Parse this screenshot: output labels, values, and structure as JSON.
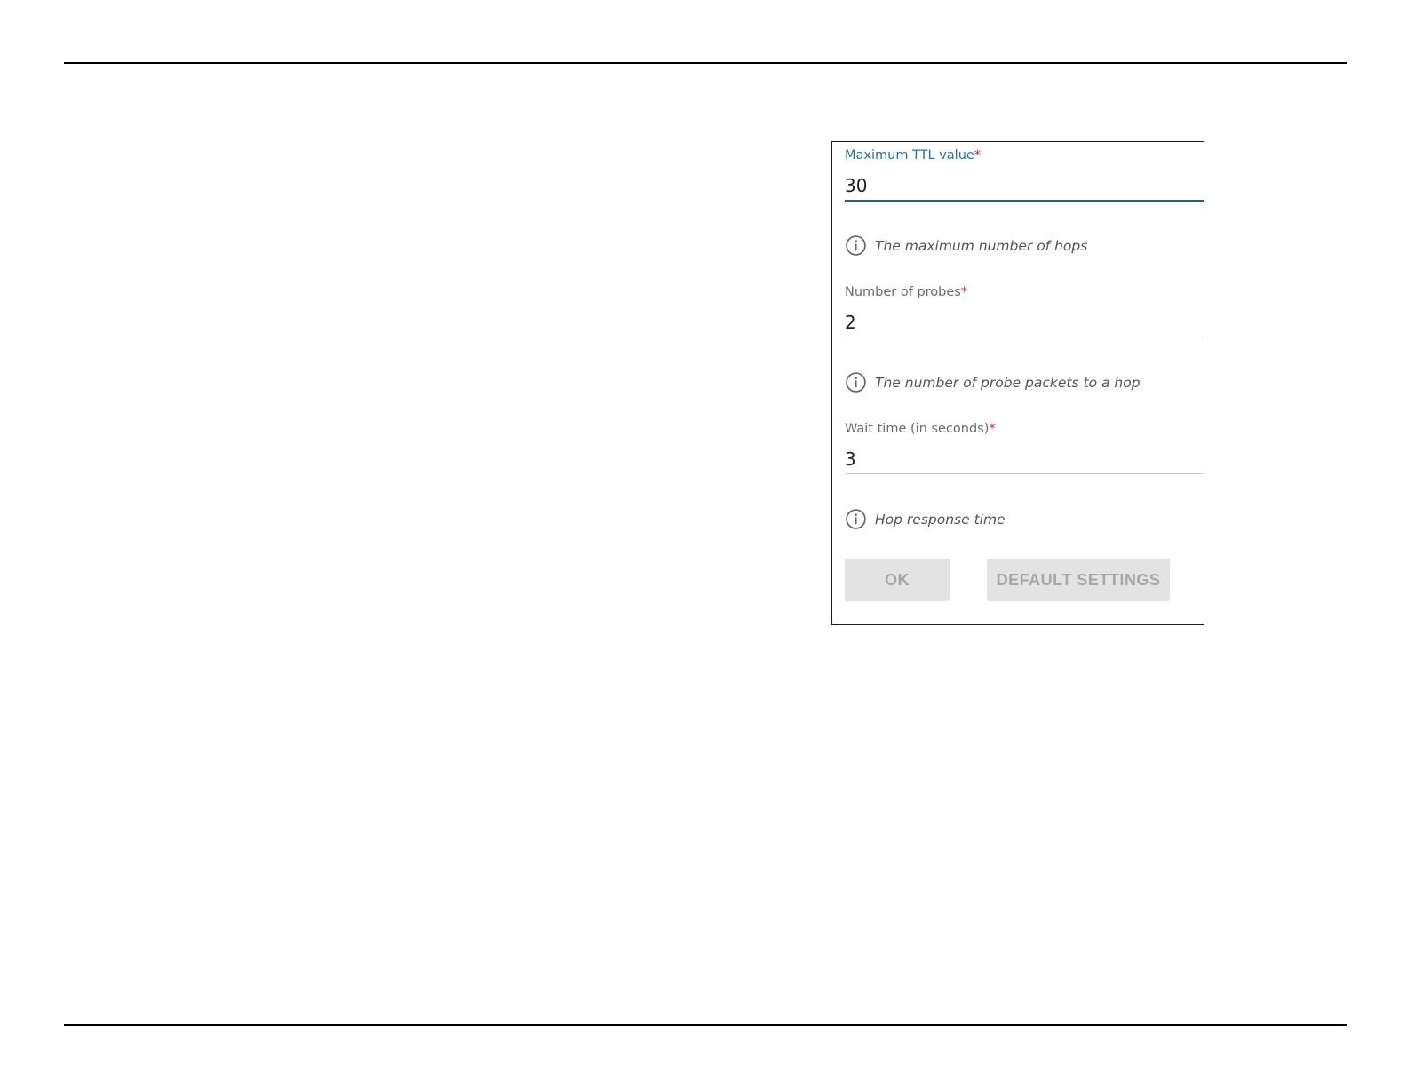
{
  "form": {
    "fields": [
      {
        "label": "Maximum TTL value",
        "required_mark": "*",
        "value": "30",
        "hint": "The maximum number of hops"
      },
      {
        "label": "Number of probes",
        "required_mark": "*",
        "value": "2",
        "hint": "The number of probe packets to a hop"
      },
      {
        "label": "Wait time (in seconds)",
        "required_mark": "*",
        "value": "3",
        "hint": "Hop response time"
      }
    ],
    "buttons": {
      "ok_label": "OK",
      "default_label": "DEFAULT SETTINGS"
    }
  },
  "colors": {
    "focused_label": "#2a6f97",
    "focused_underline": "#2a5f80",
    "required_mark": "#e02020",
    "button_bg": "#e3e3e3",
    "button_text": "#a7a7a7"
  },
  "icons": {
    "hint": "info-circle-icon"
  }
}
